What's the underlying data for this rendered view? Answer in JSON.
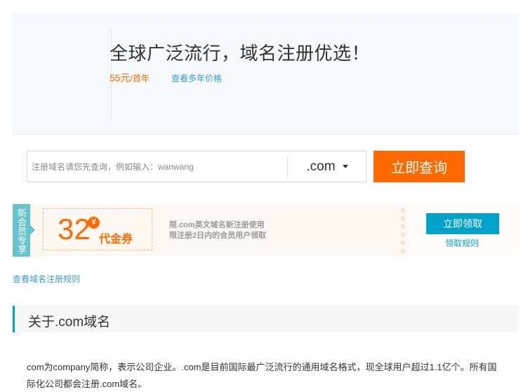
{
  "hero": {
    "title": "全球广泛流行，域名注册优选！",
    "price": "55元",
    "price_unit": "/首年",
    "multi_year_link": "查看多年价格"
  },
  "search": {
    "placeholder": "注册域名请您先查询，例如输入：wanwang",
    "tld": ".com",
    "button": "立即查询"
  },
  "coupon": {
    "member_tag": "新会员专享",
    "amount": "32",
    "currency_symbol": "¥",
    "label": "代金券",
    "desc_line1": "限.com英文域名新注册使用",
    "desc_line2": "限注册2日内的会员用户领取",
    "claim_button": "立即领取",
    "claim_rules": "领取规则"
  },
  "rules_link": "查看域名注册规则",
  "section": {
    "title": "关于.com域名",
    "description": "com为company简称，表示公司企业。.com是目前国际最广泛流行的通用域名格式，现全球用户超过1.1亿个。所有国际化公司都会注册.com域名。"
  },
  "colors": {
    "accent_orange": "#ff6a00",
    "accent_blue": "#00a2ca",
    "member_teal": "#66c5cc",
    "link_blue": "#3b9bd0"
  }
}
